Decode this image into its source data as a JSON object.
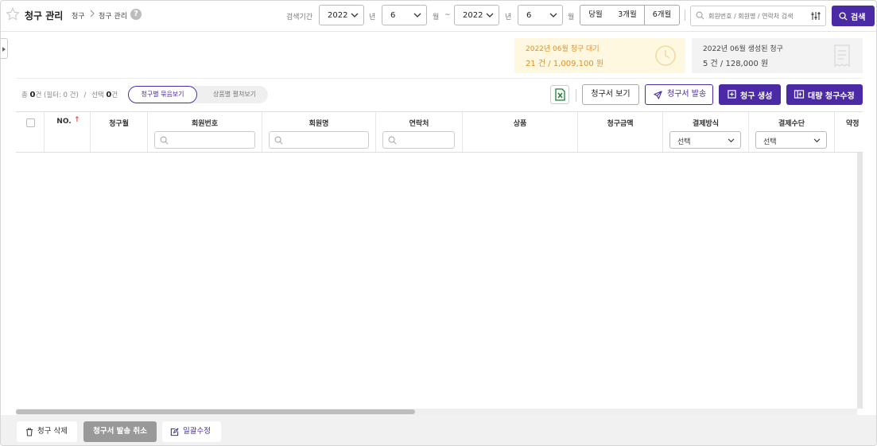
{
  "header": {
    "title": "청구 관리",
    "breadcrumb": [
      "청구",
      "청구 관리"
    ],
    "help_icon": "?",
    "period_label": "검색기간",
    "start_year": "2022",
    "year_unit": "년",
    "start_month": "6",
    "month_unit": "월",
    "range_sep": "~",
    "end_year": "2022",
    "end_month": "6",
    "quick_ranges": [
      "당월",
      "3개월",
      "6개월"
    ],
    "search_placeholder": "회원번호 / 회원명 / 연락처 검색",
    "search_button": "검색"
  },
  "summary": {
    "pending": {
      "label": "2022년 06월 청구 대기",
      "value": "21 건 / 1,009,100 원"
    },
    "generated": {
      "label": "2022년 06월 생성된 청구",
      "value": "5 건 / 128,000 원"
    }
  },
  "toolbar": {
    "total_prefix": "총",
    "total_count": "0",
    "total_suffix": "건 (필터: 0 건)",
    "divider": "/",
    "selected_prefix": "선택",
    "selected_count": "0",
    "selected_suffix": "건",
    "view_grouped": "청구별 묶음보기",
    "view_expanded": "상품별 펼쳐보기",
    "view_invoice": "청구서 보기",
    "send_invoice": "청구서 발송",
    "create_billing": "청구 생성",
    "bulk_edit": "대량 청구수정"
  },
  "table": {
    "columns": [
      "NO.",
      "청구월",
      "회원번호",
      "회원명",
      "연락처",
      "상품",
      "청구금액",
      "결제방식",
      "결제수단",
      "약정"
    ],
    "sort_indicator": "↑",
    "payment_method_filter": "선택",
    "payment_means_filter": "선택",
    "rows": []
  },
  "footer": {
    "delete": "청구 삭제",
    "cancel_send": "청구서 발송 취소",
    "bulk_modify": "일괄수정"
  },
  "colors": {
    "primary": "#4b2aa6",
    "pending_bg": "#fff8e0",
    "pending_text": "#e0902a",
    "excel_green": "#1e7e34"
  }
}
